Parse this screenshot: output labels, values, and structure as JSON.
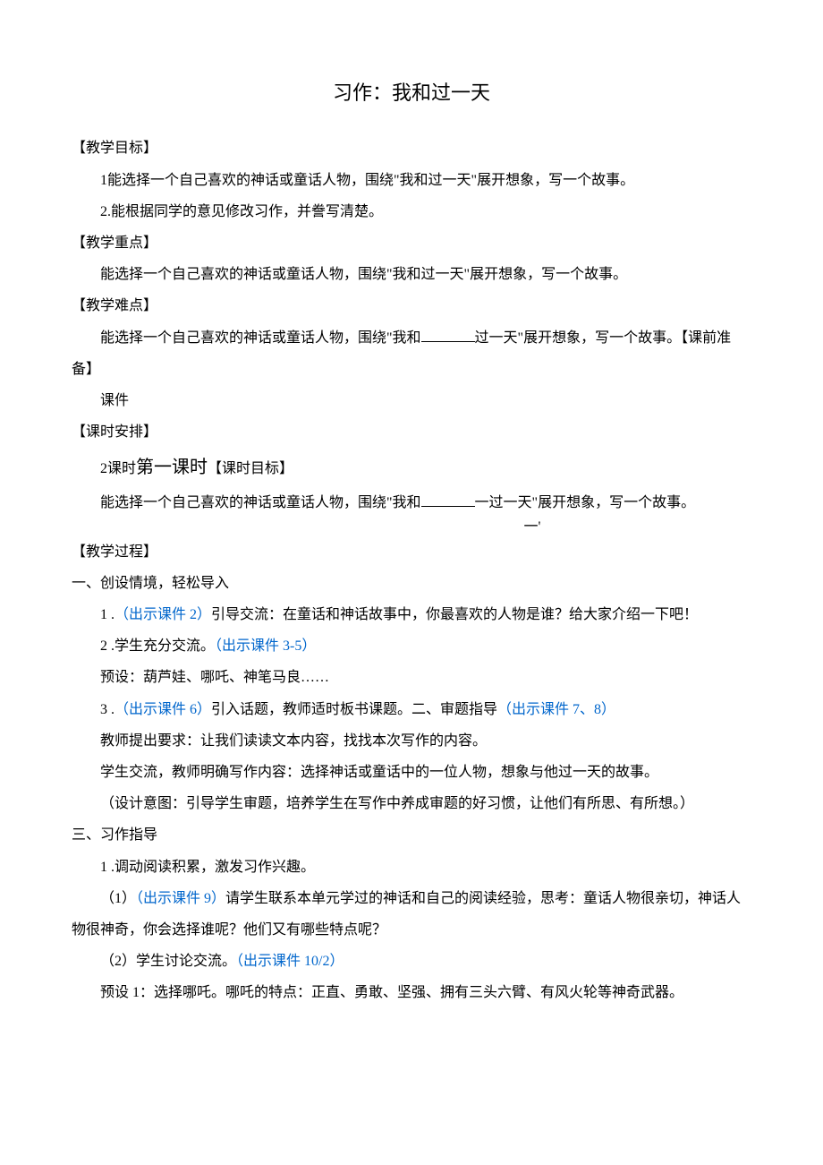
{
  "title": "习作：我和过一天",
  "sec1": {
    "label": "【教学目标】",
    "p1": "1能选择一个自己喜欢的神话或童话人物，围绕\"我和过一天\"展开想象，写一个故事。",
    "p2": "2.能根据同学的意见修改习作，并誊写清楚。"
  },
  "sec2": {
    "label": "【教学重点】",
    "p1": "能选择一个自己喜欢的神话或童话人物，围绕\"我和过一天\"展开想象，写一个故事。"
  },
  "sec3": {
    "label": "【教学难点】",
    "p1_a": "能选择一个自己喜欢的神话或童话人物，围绕\"我和",
    "p1_b": "过一天\"展开想象，写一个故事。",
    "p1_c": "【课前准备】",
    "p2": "课件"
  },
  "sec4": {
    "label": "【课时安排】",
    "p1_a": "2课时",
    "p1_b": "第一课时",
    "p1_c": "【课时目标】",
    "p2_a": "能选择一个自己喜欢的神话或童话人物，围绕\"我和",
    "p2_b": "一过一天\"展开想象，写一个故事。",
    "quote": "一'"
  },
  "sec5": {
    "label": "【教学过程】",
    "h1": "一、创设情境，轻松导入",
    "p1_a": "1 .",
    "p1_b": "（出示课件 2）",
    "p1_c": "引导交流：在童话和神话故事中，你最喜欢的人物是谁？给大家介绍一下吧！",
    "p2_a": "2       .学生充分交流。",
    "p2_b": "（出示课件 3-5）",
    "p3": "预设：葫芦娃、哪吒、神笔马良……",
    "p4_a": "3   .",
    "p4_b": "（出示课件 6）",
    "p4_c": "引入话题，教师适时板书课题。二、审题指导",
    "p4_d": "（出示课件 7、8）",
    "p5": "教师提出要求：让我们读读文本内容，找找本次写作的内容。",
    "p6": "学生交流，教师明确写作内容：选择神话或童话中的一位人物，想象与他过一天的故事。",
    "p7": "（设计意图：引导学生审题，培养学生在写作中养成审题的好习惯，让他们有所思、有所想。）",
    "h2": "三、习作指导",
    "p8": "1 .调动阅读积累，激发习作兴趣。",
    "p9_a": "（1）",
    "p9_b": "（出示课件 9）",
    "p9_c": "请学生联系本单元学过的神话和自己的阅读经验，思考：童话人物很亲切，神话人物很神奇，你会选择谁呢？他们又有哪些特点呢？",
    "p10_a": "（2）学生讨论交流。",
    "p10_b": "（出示课件 10/2）",
    "p11": "预设 1：选择哪吒。哪吒的特点：正直、勇敢、坚强、拥有三头六臂、有风火轮等神奇武器。"
  }
}
